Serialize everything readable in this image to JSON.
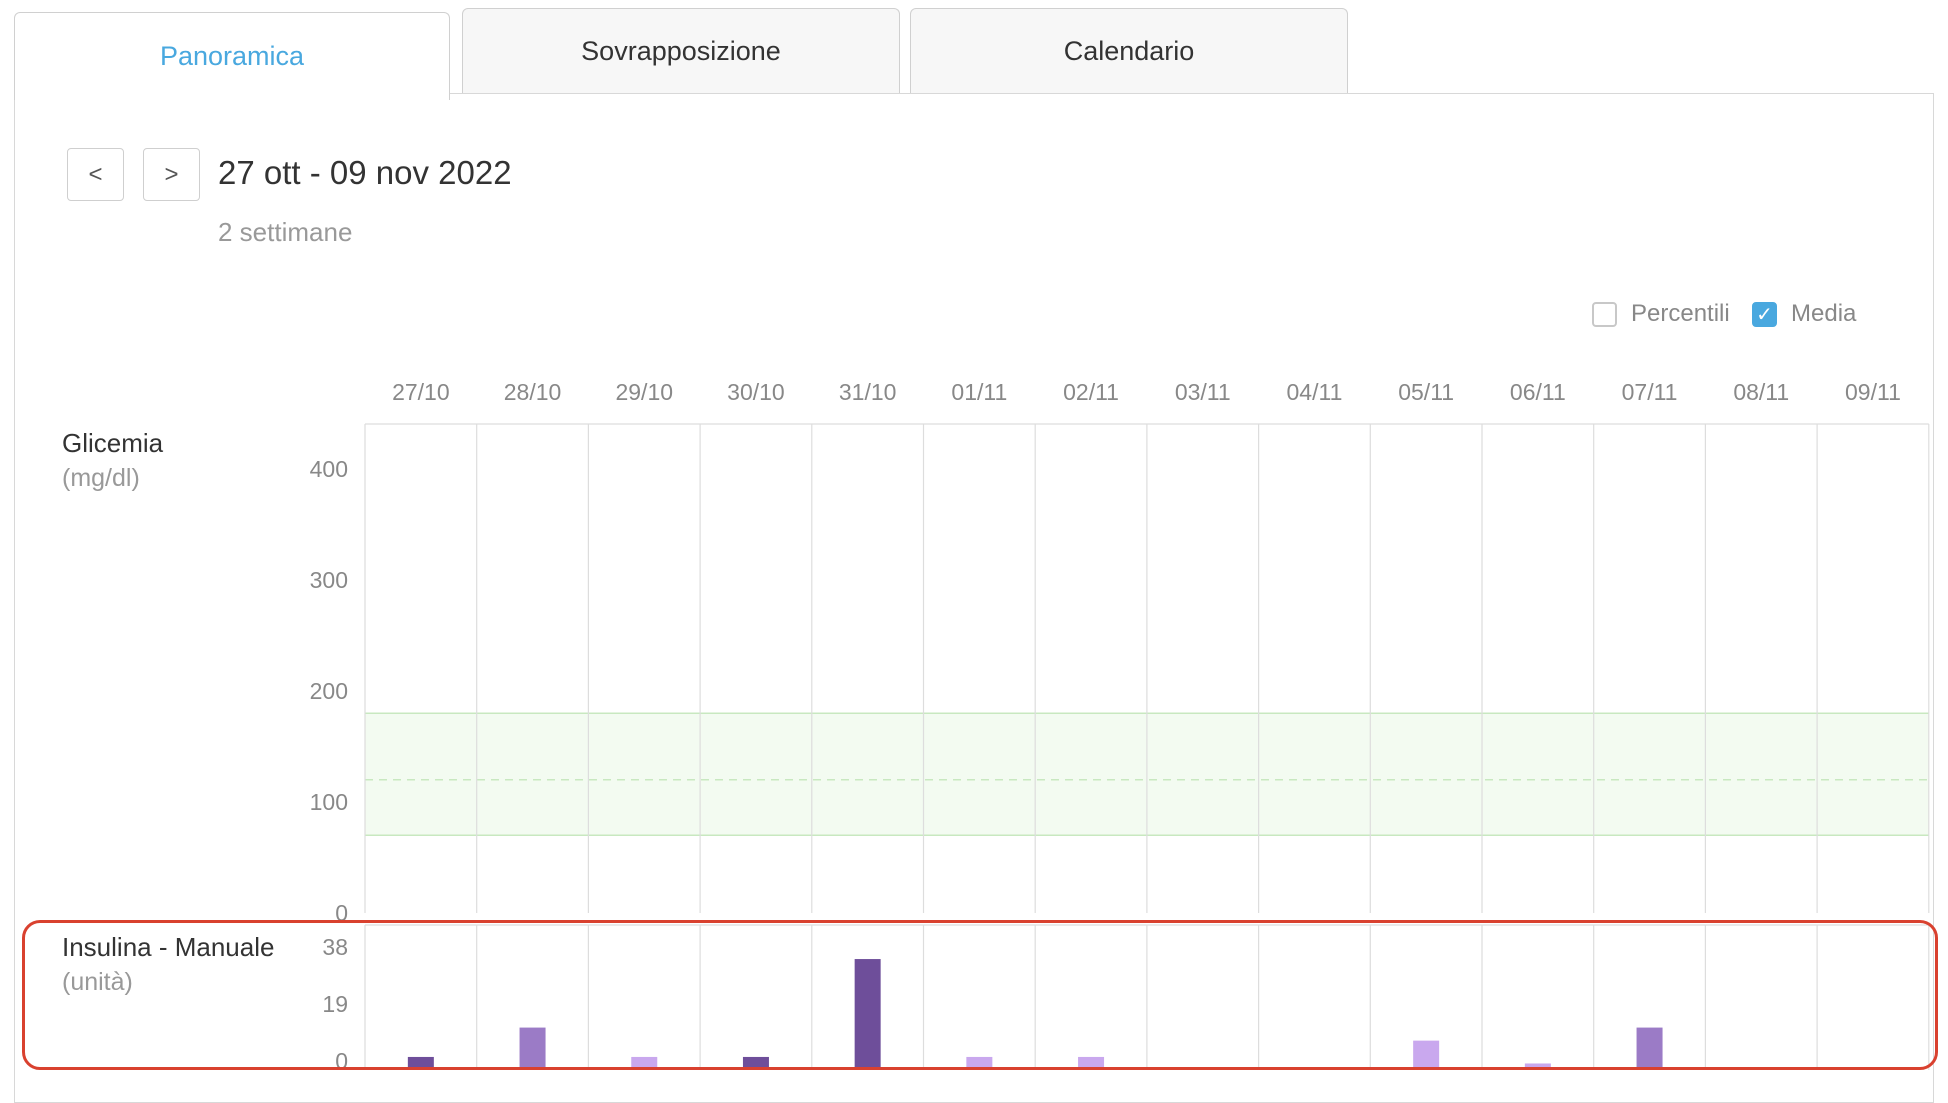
{
  "tabs": [
    {
      "label": "Panoramica",
      "active": true
    },
    {
      "label": "Sovrapposizione",
      "active": false
    },
    {
      "label": "Calendario",
      "active": false
    }
  ],
  "nav": {
    "prev_label": "<",
    "next_label": ">"
  },
  "date_range": {
    "title": "27 ott - 09 nov 2022",
    "subtitle": "2 settimane"
  },
  "options": [
    {
      "label": "Percentili",
      "checked": false
    },
    {
      "label": "Media",
      "checked": true
    }
  ],
  "glycemia": {
    "label": "Glicemia",
    "unit": "(mg/dl)",
    "ticks": [
      "400",
      "300",
      "200",
      "100",
      "0"
    ]
  },
  "insulin": {
    "label": "Insulina - Manuale",
    "unit": "(unità)",
    "ticks": [
      "38",
      "19",
      "0"
    ]
  },
  "colors": {
    "accent": "#49a8df",
    "target_band": "#f3fbf1",
    "target_line": "#c8e8c0",
    "bar_dark": "#6e4e9a",
    "bar_mid": "#9b7bc6",
    "bar_light": "#c9a8ee",
    "highlight": "#d9412f"
  },
  "chart_data": [
    {
      "type": "line",
      "title": "Glicemia",
      "ylabel": "(mg/dl)",
      "categories": [
        "27/10",
        "28/10",
        "29/10",
        "30/10",
        "31/10",
        "01/11",
        "02/11",
        "03/11",
        "04/11",
        "05/11",
        "06/11",
        "07/11",
        "08/11",
        "09/11"
      ],
      "ylim": [
        0,
        400
      ],
      "target_range": [
        70,
        180
      ],
      "target_midline": 120,
      "series": [],
      "grid": true
    },
    {
      "type": "bar",
      "title": "Insulina - Manuale",
      "ylabel": "(unità)",
      "categories": [
        "27/10",
        "28/10",
        "29/10",
        "30/10",
        "31/10",
        "01/11",
        "02/11",
        "03/11",
        "04/11",
        "05/11",
        "06/11",
        "07/11",
        "08/11",
        "09/11"
      ],
      "ylim": [
        0,
        38
      ],
      "values": [
        4,
        13,
        4,
        4,
        34,
        4,
        4,
        0,
        0,
        9,
        2,
        13,
        0,
        0
      ],
      "shades": [
        "dark",
        "mid",
        "light",
        "dark",
        "dark",
        "light",
        "light",
        "none",
        "none",
        "light",
        "light",
        "mid",
        "none",
        "none"
      ],
      "grid": true
    }
  ]
}
